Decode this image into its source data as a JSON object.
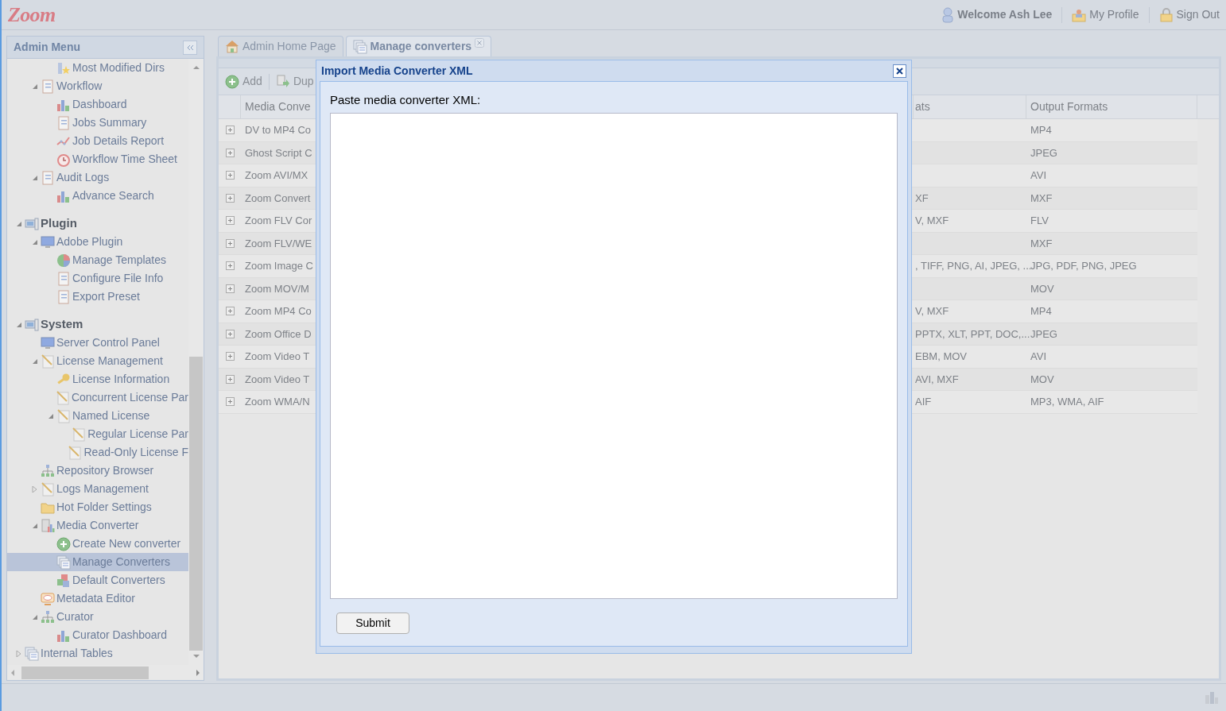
{
  "header": {
    "logo": "Zoom",
    "welcome": "Welcome Ash Lee",
    "links": [
      {
        "label": "My Profile",
        "kind": "profile"
      },
      {
        "label": "Sign Out",
        "kind": "lock"
      }
    ]
  },
  "sidebar": {
    "title": "Admin Menu",
    "tree": [
      {
        "children": [
          {
            "children": [
              {
                "label": "Most Modified Dirs",
                "kind": "star",
                "selected": false
              }
            ]
          },
          {
            "label": "Workflow",
            "kind": "doc",
            "selected": false,
            "expanded": true,
            "children": [
              {
                "label": "Dashboard",
                "kind": "chart",
                "selected": false
              },
              {
                "label": "Jobs Summary",
                "kind": "doc",
                "selected": false
              },
              {
                "label": "Job Details Report",
                "kind": "graph",
                "selected": false
              },
              {
                "label": "Workflow Time Sheet",
                "kind": "clock",
                "selected": false
              }
            ]
          },
          {
            "label": "Audit Logs",
            "kind": "doc",
            "selected": false,
            "expanded": true,
            "children": [
              {
                "label": "Advance Search",
                "kind": "chart",
                "selected": false
              }
            ]
          }
        ]
      },
      {
        "label": "Plugin",
        "kind": "server",
        "heading": true,
        "selected": false,
        "expanded": true,
        "children": [
          {
            "label": "Adobe Plugin",
            "kind": "monitor",
            "selected": false,
            "expanded": true,
            "children": [
              {
                "label": "Manage Templates",
                "kind": "pie",
                "selected": false
              },
              {
                "label": "Configure File Info",
                "kind": "doc",
                "selected": false
              },
              {
                "label": "Export Preset",
                "kind": "doc",
                "selected": false
              }
            ]
          }
        ]
      },
      {
        "label": "System",
        "kind": "server",
        "heading": true,
        "selected": false,
        "expanded": true,
        "children": [
          {
            "label": "Server Control Panel",
            "kind": "monitor",
            "selected": false
          },
          {
            "label": "License Management",
            "kind": "license",
            "selected": false,
            "expanded": true,
            "children": [
              {
                "label": "License Information",
                "kind": "key",
                "selected": false
              },
              {
                "label": "Concurrent License Par",
                "kind": "license",
                "selected": false
              },
              {
                "label": "Named License",
                "kind": "license",
                "selected": false,
                "expanded": true,
                "children": [
                  {
                    "label": "Regular License Par",
                    "kind": "license",
                    "selected": false
                  },
                  {
                    "label": "Read-Only License F",
                    "kind": "license",
                    "selected": false
                  }
                ]
              }
            ]
          },
          {
            "label": "Repository Browser",
            "kind": "network",
            "selected": false
          },
          {
            "label": "Logs Management",
            "kind": "license",
            "selected": false,
            "expanded": false
          },
          {
            "label": "Hot Folder Settings",
            "kind": "folder",
            "selected": false
          },
          {
            "label": "Media Converter",
            "kind": "converter",
            "selected": false,
            "expanded": true,
            "children": [
              {
                "label": "Create New converter",
                "kind": "add",
                "selected": false
              },
              {
                "label": "Manage Converters",
                "kind": "stack",
                "selected": true
              },
              {
                "label": "Default Converters",
                "kind": "cubes",
                "selected": false
              }
            ]
          },
          {
            "label": "Metadata Editor",
            "kind": "editor",
            "selected": false
          },
          {
            "label": "Curator",
            "kind": "network",
            "selected": false,
            "expanded": true,
            "children": [
              {
                "label": "Curator Dashboard",
                "kind": "chart",
                "selected": false
              }
            ]
          }
        ]
      },
      {
        "label": "Internal Tables",
        "kind": "stack",
        "heading": false,
        "selected": false,
        "expanded": false
      }
    ]
  },
  "tabs": [
    {
      "label": "Admin Home Page",
      "kind": "home",
      "selected": false,
      "closable": false
    },
    {
      "label": "Manage converters",
      "kind": "stack",
      "selected": true,
      "closable": true
    }
  ],
  "toolbar": [
    {
      "label": "Add",
      "kind": "add"
    },
    {
      "label": "Dup",
      "kind": "duplicate"
    }
  ],
  "table": {
    "columns": [
      "Media Conve",
      "ats",
      "Output Formats"
    ],
    "rows": [
      [
        "DV to MP4 Co",
        "",
        "MP4"
      ],
      [
        "Ghost Script C",
        "",
        "JPEG"
      ],
      [
        "Zoom AVI/MX",
        "",
        "AVI"
      ],
      [
        "Zoom Convert",
        "XF",
        "MXF"
      ],
      [
        "Zoom FLV Cor",
        "V, MXF",
        "FLV"
      ],
      [
        "Zoom FLV/WE",
        "",
        "MXF"
      ],
      [
        "Zoom Image C",
        ", TIFF, PNG, AI, JPEG, ...",
        "JPG, PDF, PNG, JPEG"
      ],
      [
        "Zoom MOV/M",
        "",
        "MOV"
      ],
      [
        "Zoom MP4 Co",
        "V, MXF",
        "MP4"
      ],
      [
        "Zoom Office D",
        "PPTX, XLT, PPT, DOC,...",
        "JPEG"
      ],
      [
        "Zoom Video T",
        "EBM, MOV",
        "AVI"
      ],
      [
        "Zoom Video T",
        "AVI, MXF",
        "MOV"
      ],
      [
        "Zoom WMA/N",
        "AIF",
        "MP3, WMA, AIF"
      ]
    ]
  },
  "dialog": {
    "title": "Import Media Converter XML",
    "label": "Paste media converter XML:",
    "button": "Submit"
  }
}
